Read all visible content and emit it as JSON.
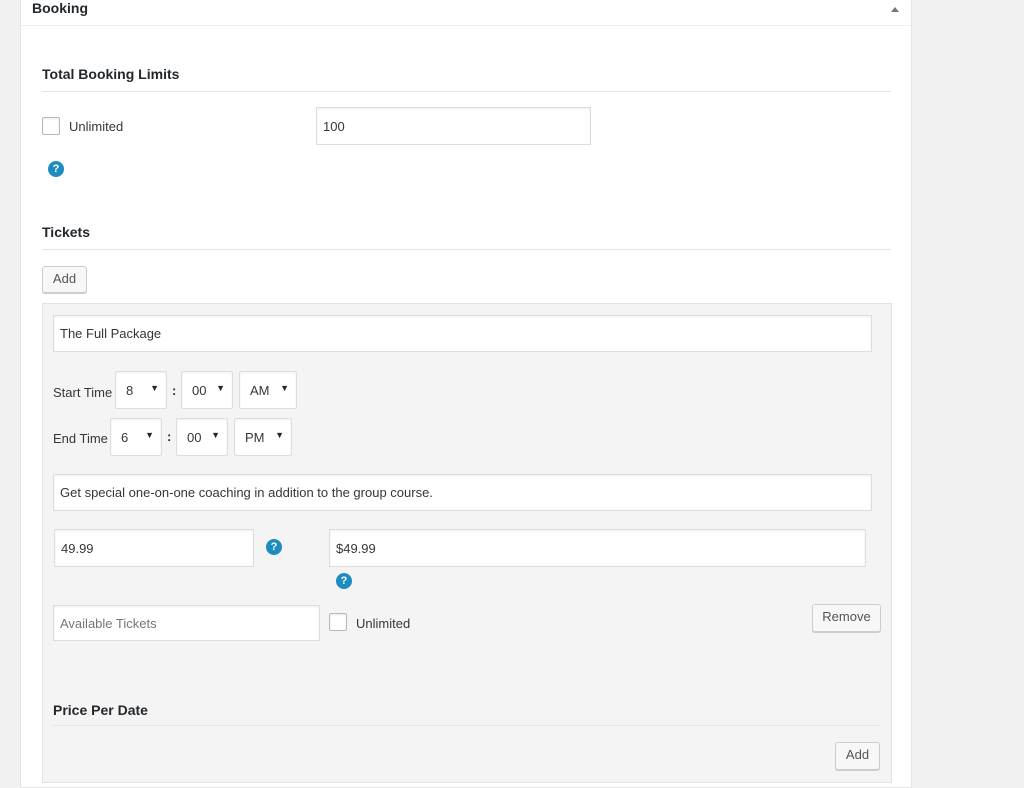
{
  "panel": {
    "title": "Booking"
  },
  "limits": {
    "section_title": "Total Booking Limits",
    "unlimited_label": "Unlimited",
    "limit_value": "100",
    "help": "?"
  },
  "tickets": {
    "section_title": "Tickets",
    "add_label": "Add",
    "ticket": {
      "name": "The Full Package",
      "start_time": {
        "label": "Start Time",
        "hour": "8",
        "minute": "00",
        "ampm": "AM"
      },
      "end_time": {
        "label": "End Time",
        "hour": "6",
        "minute": "00",
        "ampm": "PM"
      },
      "time_separator": ":",
      "description": "Get special one-on-one coaching in addition to the group course.",
      "price": "49.99",
      "price_label": "$49.99",
      "available_placeholder": "Available Tickets",
      "unlimited_label": "Unlimited",
      "remove_label": "Remove",
      "help": "?"
    },
    "price_per_date": {
      "title": "Price Per Date",
      "add_label": "Add"
    }
  },
  "icons": {
    "help": "question-circle-icon",
    "collapse": "triangle-up-icon",
    "select_caret": "caret-down-icon"
  },
  "colors": {
    "help_icon": "#1e8cbe",
    "panel_bg": "#ffffff",
    "ticket_bg": "#f4f4f4",
    "page_bg": "#f1f1f1"
  }
}
